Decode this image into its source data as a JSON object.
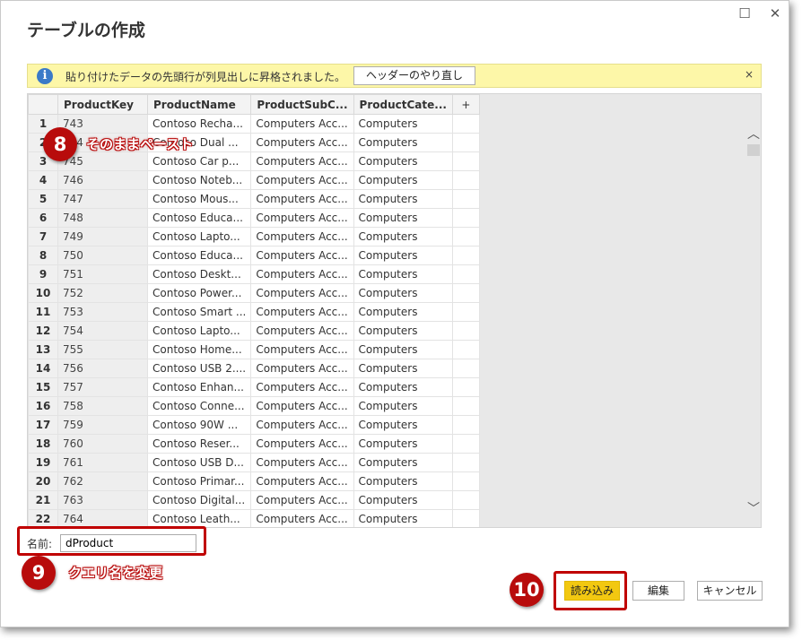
{
  "window": {
    "title": "テーブルの作成",
    "maximize_glyph": "☐",
    "close_glyph": "✕"
  },
  "infobar": {
    "icon": "info-icon",
    "icon_glyph": "i",
    "message": "貼り付けたデータの先頭行が列見出しに昇格されました。",
    "button_label": "ヘッダーのやり直し",
    "close_glyph": "×"
  },
  "table": {
    "columns": [
      "ProductKey",
      "ProductName",
      "ProductSubC...",
      "ProductCate..."
    ],
    "add_column_glyph": "+",
    "rows": [
      {
        "n": "1",
        "key": "743",
        "name": "Contoso Recha...",
        "sub": "Computers Acc...",
        "cat": "Computers"
      },
      {
        "n": "2",
        "key": "744",
        "name": "Contoso Dual ...",
        "sub": "Computers Acc...",
        "cat": "Computers"
      },
      {
        "n": "3",
        "key": "745",
        "name": "Contoso Car p...",
        "sub": "Computers Acc...",
        "cat": "Computers"
      },
      {
        "n": "4",
        "key": "746",
        "name": "Contoso Noteb...",
        "sub": "Computers Acc...",
        "cat": "Computers"
      },
      {
        "n": "5",
        "key": "747",
        "name": "Contoso Mous...",
        "sub": "Computers Acc...",
        "cat": "Computers"
      },
      {
        "n": "6",
        "key": "748",
        "name": "Contoso Educa...",
        "sub": "Computers Acc...",
        "cat": "Computers"
      },
      {
        "n": "7",
        "key": "749",
        "name": "Contoso Lapto...",
        "sub": "Computers Acc...",
        "cat": "Computers"
      },
      {
        "n": "8",
        "key": "750",
        "name": "Contoso Educa...",
        "sub": "Computers Acc...",
        "cat": "Computers"
      },
      {
        "n": "9",
        "key": "751",
        "name": "Contoso Deskt...",
        "sub": "Computers Acc...",
        "cat": "Computers"
      },
      {
        "n": "10",
        "key": "752",
        "name": "Contoso Power...",
        "sub": "Computers Acc...",
        "cat": "Computers"
      },
      {
        "n": "11",
        "key": "753",
        "name": "Contoso Smart ...",
        "sub": "Computers Acc...",
        "cat": "Computers"
      },
      {
        "n": "12",
        "key": "754",
        "name": "Contoso Lapto...",
        "sub": "Computers Acc...",
        "cat": "Computers"
      },
      {
        "n": "13",
        "key": "755",
        "name": "Contoso Home...",
        "sub": "Computers Acc...",
        "cat": "Computers"
      },
      {
        "n": "14",
        "key": "756",
        "name": "Contoso USB 2....",
        "sub": "Computers Acc...",
        "cat": "Computers"
      },
      {
        "n": "15",
        "key": "757",
        "name": "Contoso Enhan...",
        "sub": "Computers Acc...",
        "cat": "Computers"
      },
      {
        "n": "16",
        "key": "758",
        "name": "Contoso Conne...",
        "sub": "Computers Acc...",
        "cat": "Computers"
      },
      {
        "n": "17",
        "key": "759",
        "name": "Contoso 90W ...",
        "sub": "Computers Acc...",
        "cat": "Computers"
      },
      {
        "n": "18",
        "key": "760",
        "name": "Contoso Reser...",
        "sub": "Computers Acc...",
        "cat": "Computers"
      },
      {
        "n": "19",
        "key": "761",
        "name": "Contoso USB D...",
        "sub": "Computers Acc...",
        "cat": "Computers"
      },
      {
        "n": "20",
        "key": "762",
        "name": "Contoso Primar...",
        "sub": "Computers Acc...",
        "cat": "Computers"
      },
      {
        "n": "21",
        "key": "763",
        "name": "Contoso Digital...",
        "sub": "Computers Acc...",
        "cat": "Computers"
      },
      {
        "n": "22",
        "key": "764",
        "name": "Contoso Leath...",
        "sub": "Computers Acc...",
        "cat": "Computers"
      }
    ]
  },
  "scrollbar": {
    "up_glyph": "︿",
    "down_glyph": "﹀"
  },
  "name_field": {
    "label": "名前:",
    "value": "dProduct"
  },
  "buttons": {
    "load": "読み込み",
    "edit": "編集",
    "cancel": "キャンセル"
  },
  "annotations": [
    {
      "number": "8",
      "text": "そのままペースト"
    },
    {
      "number": "9",
      "text": "クエリ名を変更"
    },
    {
      "number": "10",
      "text": ""
    }
  ],
  "colors": {
    "accent": "#f2c811",
    "annotation_red": "#b80c0c",
    "infobar_bg": "#fdf7a8"
  }
}
